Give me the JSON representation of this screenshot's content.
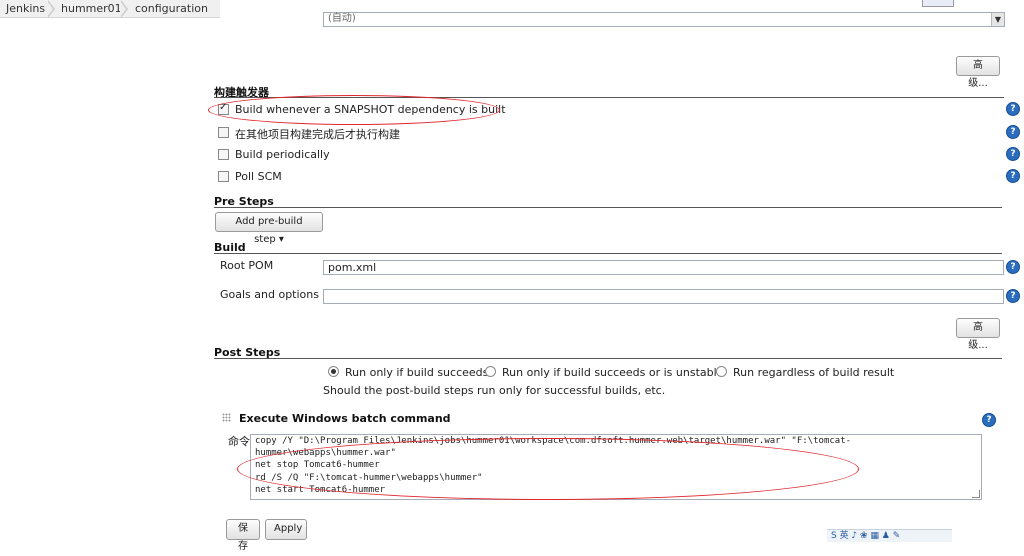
{
  "breadcrumb": [
    "Jenkins",
    "hummer01",
    "configuration"
  ],
  "top_select": {
    "label": "",
    "value": "(自动)"
  },
  "advanced_label": "高级...",
  "build_triggers": {
    "title": "构建触发器",
    "items": [
      {
        "label": "Build whenever a SNAPSHOT dependency is built",
        "checked": true
      },
      {
        "label": "在其他项目构建完成后才执行构建",
        "checked": false
      },
      {
        "label": "Build periodically",
        "checked": false
      },
      {
        "label": "Poll SCM",
        "checked": false
      }
    ]
  },
  "pre_steps": {
    "title": "Pre Steps",
    "add_button": "Add pre-build step"
  },
  "build": {
    "title": "Build",
    "root_pom_label": "Root POM",
    "root_pom_value": "pom.xml",
    "goals_label": "Goals and options",
    "goals_value": ""
  },
  "post_steps": {
    "title": "Post Steps",
    "options": [
      {
        "label": "Run only if build succeeds",
        "selected": true
      },
      {
        "label": "Run only if build succeeds or is unstable",
        "selected": false
      },
      {
        "label": "Run regardless of build result",
        "selected": false
      }
    ],
    "description": "Should the post-build steps run only for successful builds, etc."
  },
  "batch_step": {
    "title": "Execute Windows batch command",
    "command_label": "命令",
    "command_lines": [
      "copy /Y \"D:\\Program Files\\Jenkins\\jobs\\hummer01\\workspace\\com.dfsoft.hummer.web\\target\\hummer.war\" \"F:\\tomcat-",
      "hummer\\webapps\\hummer.war\"",
      "net stop Tomcat6-hummer",
      "rd /S /Q \"F:\\tomcat-hummer\\webapps\\hummer\"",
      "net start Tomcat6-hummer"
    ]
  },
  "footer": {
    "save_label": "保存",
    "apply_label": "Apply"
  },
  "help_icon_glyph": "?",
  "ime_text": "S 英 ♪ ❀ ▦ ♟ ✎",
  "colors": {
    "annotation": "#e0262c",
    "help_icon": "#2a6dbf"
  }
}
